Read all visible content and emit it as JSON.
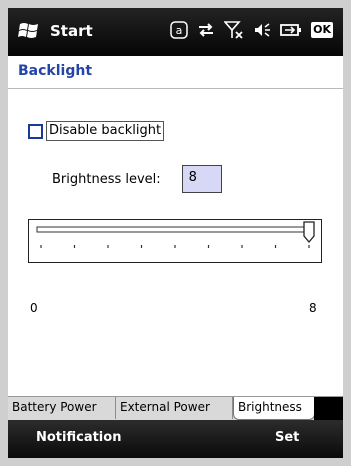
{
  "statusbar": {
    "start_label": "Start",
    "icons": [
      "a-key-icon",
      "sync-arrows-icon",
      "no-signal-icon",
      "speaker-icon",
      "battery-icon",
      "ok-button"
    ],
    "a_label": "a",
    "ok_label": "OK"
  },
  "header": {
    "title": "Backlight"
  },
  "settings": {
    "disable_backlight_label": "Disable backlight",
    "disable_backlight_checked": false,
    "brightness_label": "Brightness level:",
    "brightness_value": "8",
    "slider": {
      "min": "0",
      "max": "8",
      "value": 8,
      "ticks": 9
    }
  },
  "tabs": [
    {
      "label": "Battery Power",
      "active": false
    },
    {
      "label": "External Power",
      "active": false
    },
    {
      "label": "Brightness",
      "active": true
    }
  ],
  "softkeys": {
    "left": "Notification",
    "right": "Set"
  },
  "colors": {
    "title": "#2445a8",
    "checkbox_border": "#193a9a",
    "input_bg": "#d7d8f5",
    "bar_bg": "#000000"
  }
}
